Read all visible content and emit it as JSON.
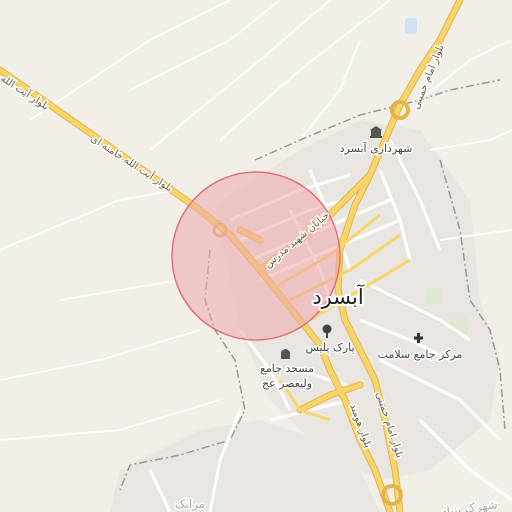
{
  "map": {
    "city_label": "آبسرد",
    "roads": {
      "ayatollah_khamenei": "بلوار آیت الله خامنه ای",
      "ayatollah_top": "بلوار آیت الله",
      "shahid_modarres": "خیابان شهید مدرس",
      "imam_khomeini_north": "بلوار امام خمینی",
      "imam_khomeini_south": "بلوار امام خمینی",
      "south_blvd": "بلوار هومند"
    },
    "pois": {
      "municipality": "شهرداری آبسرد",
      "park": "پارک پلیس",
      "health_center": "مرکز جامع سلامت",
      "mosque": "مسجد جامع ولیعصر عج",
      "mosque_line1": "مسجد جامع",
      "mosque_line2": "ولیعصر عج"
    },
    "faint_labels": {
      "bottom_left": "مرانک",
      "bottom_right": "شهرک بنیاد"
    },
    "colors": {
      "background": "#f2efe9",
      "major_road": "#f7d56b",
      "major_road_casing": "#e2b54a",
      "minor_road": "#ffffff",
      "selection_fill": "#f1a7ad",
      "selection_stroke": "#e0707a",
      "boundary": "#999999"
    }
  }
}
